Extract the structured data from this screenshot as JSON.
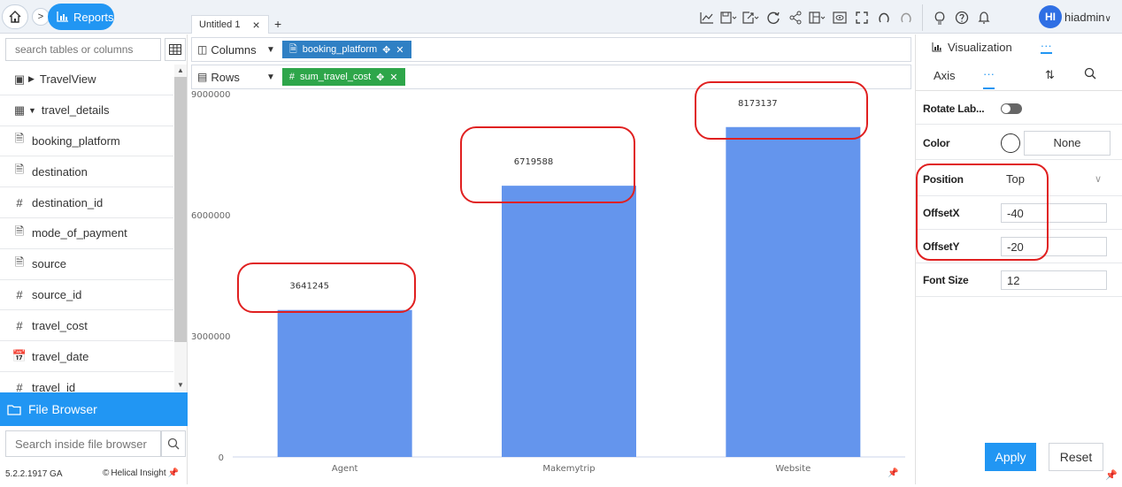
{
  "header": {
    "breadcrumb": {
      "section_label": "Reports"
    },
    "tabs": [
      {
        "label": "Untitled 1"
      }
    ],
    "add_tab_label": "+",
    "close_tab_label": "×",
    "user": {
      "initials": "HI",
      "name": "hiadmin"
    }
  },
  "sidebar": {
    "search_placeholder": "search tables or columns",
    "items": [
      {
        "label": "TravelView",
        "icon": "view-icon"
      },
      {
        "label": "travel_details",
        "icon": "table-icon"
      },
      {
        "label": "booking_platform",
        "icon": "text-field-icon"
      },
      {
        "label": "destination",
        "icon": "text-field-icon"
      },
      {
        "label": "destination_id",
        "icon": "number-field-icon"
      },
      {
        "label": "mode_of_payment",
        "icon": "text-field-icon"
      },
      {
        "label": "source",
        "icon": "text-field-icon"
      },
      {
        "label": "source_id",
        "icon": "number-field-icon"
      },
      {
        "label": "travel_cost",
        "icon": "number-field-icon"
      },
      {
        "label": "travel_date",
        "icon": "calendar-icon"
      },
      {
        "label": "travel_id",
        "icon": "number-field-icon"
      }
    ],
    "file_browser_label": "File Browser",
    "file_search_placeholder": "Search inside file browser",
    "version": "5.2.2.1917 GA",
    "brand": "Helical Insight"
  },
  "shelves": {
    "columns": {
      "label": "Columns",
      "pill": "booking_platform"
    },
    "rows": {
      "label": "Rows",
      "pill": "sum_travel_cost"
    }
  },
  "chart_data": {
    "type": "bar",
    "categories": [
      "Agent",
      "Makemytrip",
      "Website"
    ],
    "values": [
      3641245,
      6719588,
      8173137
    ],
    "yticks": [
      0,
      3000000,
      6000000,
      9000000
    ],
    "ylim": [
      0,
      9000000
    ],
    "xlabel": "",
    "ylabel": "",
    "title": "",
    "bar_color": "#6495ed",
    "data_labels": [
      "3641245",
      "6719588",
      "8173137"
    ],
    "grid": false
  },
  "properties": {
    "tabs": {
      "visualization": "Visualization",
      "more": "···"
    },
    "subtabs": {
      "axis": "Axis",
      "more": "···"
    },
    "rotate_labels_label": "Rotate Lab...",
    "color_label": "Color",
    "color_value": "None",
    "position_label": "Position",
    "position_value": "Top",
    "offset_x_label": "OffsetX",
    "offset_x_value": "-40",
    "offset_y_label": "OffsetY",
    "offset_y_value": "-20",
    "font_size_label": "Font Size",
    "font_size_value": "12",
    "apply_label": "Apply",
    "reset_label": "Reset"
  },
  "colors": {
    "accent": "#2196f3",
    "annotation": "#e02020"
  }
}
